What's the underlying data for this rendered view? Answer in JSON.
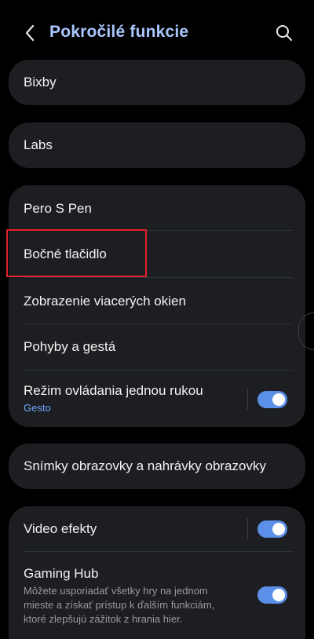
{
  "header": {
    "title": "Pokročilé funkcie",
    "back_icon": "back-chevron-icon",
    "search_icon": "search-icon"
  },
  "items": {
    "bixby": "Bixby",
    "labs": "Labs",
    "pen": "Pero S Pen",
    "side_key": "Bočné tlačidlo",
    "multi_window": "Zobrazenie viacerých okien",
    "motions": "Pohyby a gestá",
    "one_handed": "Režim ovládania jednou rukou",
    "one_handed_sub": "Gesto",
    "screenshots": "Snímky obrazovky a nahrávky obrazovky",
    "video_effects": "Video efekty",
    "gaming_hub": "Gaming Hub",
    "gaming_hub_desc": "Môžete usporiadať všetky hry na jednom mieste a získať prístup k ďalším funkciám, ktoré zlepšujú zážitok z hrania hier."
  },
  "toggles": {
    "one_handed": true,
    "video_effects": true,
    "gaming_hub": true
  },
  "colors": {
    "accent": "#a9c8ff",
    "toggle_on": "#5b8fe8",
    "card_bg": "#1c1e21",
    "highlight": "#e0232c"
  }
}
